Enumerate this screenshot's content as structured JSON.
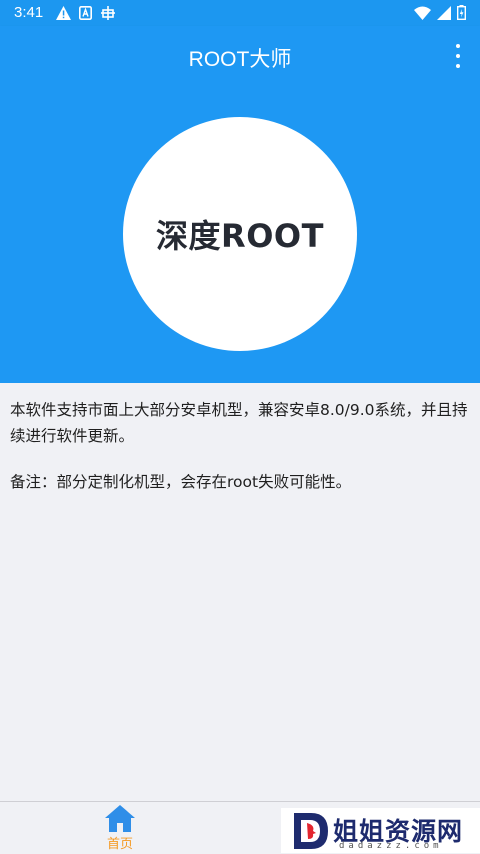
{
  "status_bar": {
    "time": "3:41",
    "left_icons": [
      "warning-icon",
      "a-box-icon",
      "bug-icon"
    ],
    "right_icons": [
      "wifi-icon",
      "signal-icon",
      "battery-icon"
    ]
  },
  "app_bar": {
    "title": "ROOT大师",
    "menu_icon": "more-vert-icon"
  },
  "hero": {
    "button_label": "深度ROOT"
  },
  "content": {
    "description": "本软件支持市面上大部分安卓机型，兼容安卓8.0/9.0系统，并且持续进行软件更新。",
    "note": "备注：部分定制化机型，会存在root失败可能性。"
  },
  "bottom_nav": {
    "home_label": "首页",
    "active_color": "#f59a23",
    "icon_color": "#2f8ee8"
  },
  "watermark": {
    "text": "姐姐资源网",
    "subtext": "dadazzz.com"
  },
  "colors": {
    "primary": "#1e98f3",
    "background": "#f0f1f5"
  }
}
